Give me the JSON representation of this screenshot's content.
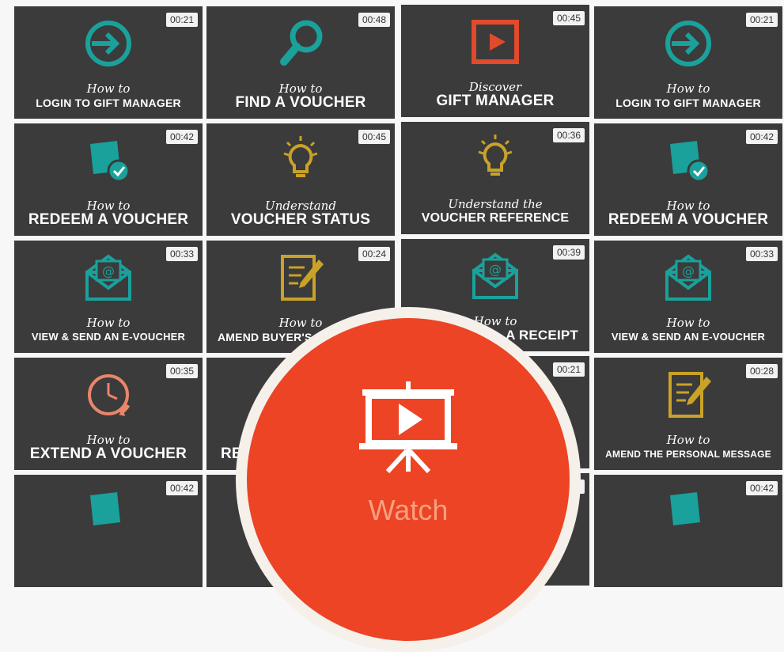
{
  "tiles": [
    {
      "duration": "00:21",
      "how": "How to",
      "title": "LOGIN TO GIFT MANAGER"
    },
    {
      "duration": "00:48",
      "how": "How to",
      "title": "FIND A VOUCHER"
    },
    {
      "duration": "00:45",
      "how": "Discover",
      "title": "GIFT MANAGER"
    },
    {
      "duration": "00:21",
      "how": "How to",
      "title": "LOGIN TO GIFT MANAGER"
    },
    {
      "duration": "00:42",
      "how": "How to",
      "title": "REDEEM A VOUCHER"
    },
    {
      "duration": "00:45",
      "how": "Understand",
      "title": "VOUCHER STATUS"
    },
    {
      "duration": "00:36",
      "how": "Understand the",
      "title": "VOUCHER REFERENCE"
    },
    {
      "duration": "00:42",
      "how": "How to",
      "title": "REDEEM A VOUCHER"
    },
    {
      "duration": "00:33",
      "how": "How to",
      "title": "VIEW & SEND AN E-VOUCHER"
    },
    {
      "duration": "00:24",
      "how": "How to",
      "title": "AMEND BUYER'S"
    },
    {
      "duration": "00:39",
      "how": "How to",
      "title": "A RECEIPT"
    },
    {
      "duration": "00:33",
      "how": "How to",
      "title": "VIEW & SEND AN E-VOUCHER"
    },
    {
      "duration": "00:35",
      "how": "How to",
      "title": "EXTEND A VOUCHER"
    },
    {
      "duration": "",
      "how": "",
      "title": "RE"
    },
    {
      "duration": "00:21",
      "how": "",
      "title": ""
    },
    {
      "duration": "00:28",
      "how": "How to",
      "title": "AMEND THE PERSONAL MESSAGE"
    },
    {
      "duration": "00:42",
      "how": "",
      "title": ""
    },
    {
      "duration": "",
      "how": "",
      "title": ""
    },
    {
      "duration": "6",
      "how": "",
      "title": ""
    },
    {
      "duration": "00:42",
      "how": "",
      "title": ""
    }
  ],
  "overlay": {
    "label": "Watch"
  },
  "colors": {
    "teal": "#1aa19b",
    "gold": "#c9a227",
    "red": "#e14a2c",
    "salmon": "#e9866b",
    "tile": "#3b3b3b",
    "accent": "#ec4424"
  }
}
